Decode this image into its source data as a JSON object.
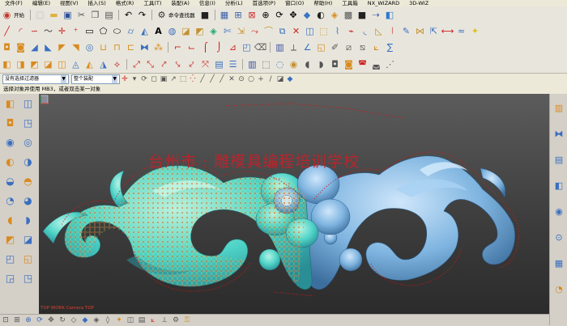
{
  "menu": [
    "文件(F)",
    "编辑(E)",
    "视图(V)",
    "插入(S)",
    "格式(R)",
    "工具(T)",
    "装配(A)",
    "信息(I)",
    "分析(L)",
    "首选项(P)",
    "窗口(O)",
    "帮助(H)",
    "工具箱",
    "NX_WIZARD",
    "3D-WIZ"
  ],
  "toolbar": {
    "start_label": "开始",
    "command_finder": "命令查找器"
  },
  "selection": {
    "filter_value": "没有选择过滤器",
    "scope_value": "整个装配",
    "prompt": "选择对象并使用 MB3，或者双击某一对象"
  },
  "viewport": {
    "watermark": "台州市 · 雕模具编程培训学校",
    "view_label": "TOP WORK Camera TOP"
  },
  "colors": {
    "menu_bg": "#ece9d8",
    "viewport_top": "#5c5c5c",
    "viewport_bottom": "#2b2b2b",
    "ornament_blue": "#7fb5e0",
    "ornament_cyan": "#4fd3c7",
    "toolpath_red": "#d01818",
    "watermark_red": "#cd1e28"
  },
  "icons": {
    "toolbar_row1": [
      "start-icon",
      "new-icon",
      "open-icon",
      "save-icon",
      "cut-icon",
      "copy-icon",
      "paste-icon",
      "undo-icon",
      "redo-icon",
      "repeat-icon",
      "command-finder-icon",
      "display-icon",
      "window-icon",
      "view-orient-icon",
      "fit-icon",
      "zoom-icon",
      "rotate-icon",
      "pan-icon",
      "render-icon",
      "shade-icon",
      "wireframe-icon",
      "layer-icon",
      "measure-icon"
    ],
    "toolbar_row2": [
      "line-icon",
      "arc-icon",
      "spline-icon",
      "curve-icon",
      "point-icon",
      "rectangle-icon",
      "polygon-icon",
      "ellipse-icon",
      "cylinder-icon",
      "cone-icon",
      "text-icon",
      "sphere-icon",
      "block-icon",
      "surface-icon",
      "mesh-icon",
      "trim-icon",
      "extend-icon",
      "offset-icon"
    ],
    "toolbar_row3": [
      "extrude-icon",
      "revolve-icon",
      "sweep-icon",
      "blend-icon",
      "chamfer-icon",
      "shell-icon",
      "hole-icon",
      "boolean-unite-icon",
      "boolean-subtract-icon",
      "boolean-intersect-icon",
      "mirror-icon",
      "pattern-icon",
      "draft-icon",
      "thicken-icon",
      "sew-icon",
      "patch-icon"
    ],
    "toolbar_row4": [
      "create-program-icon",
      "create-tool-icon",
      "create-geometry-icon",
      "create-method-icon",
      "create-operation-icon",
      "generate-path-icon",
      "verify-path-icon",
      "simulate-icon",
      "postprocess-icon",
      "shop-doc-icon",
      "list-icon",
      "edit-icon"
    ],
    "left_tools": [
      "feature-icon",
      "block-icon",
      "cylinder-icon",
      "cone-icon",
      "sphere-icon",
      "hole-icon",
      "boss-icon",
      "pocket-icon",
      "pad-icon",
      "slot-icon",
      "groove-icon",
      "edge-blend-icon",
      "chamfer-icon",
      "shell-icon",
      "draft-icon",
      "extract-icon",
      "instance-icon",
      "sew-icon",
      "trim-body-icon",
      "split-icon"
    ],
    "right_tools": [
      "navigator-icon",
      "assembly-icon",
      "history-icon",
      "reuse-icon",
      "web-icon",
      "roles-icon",
      "palette-icon",
      "systems-icon"
    ]
  }
}
